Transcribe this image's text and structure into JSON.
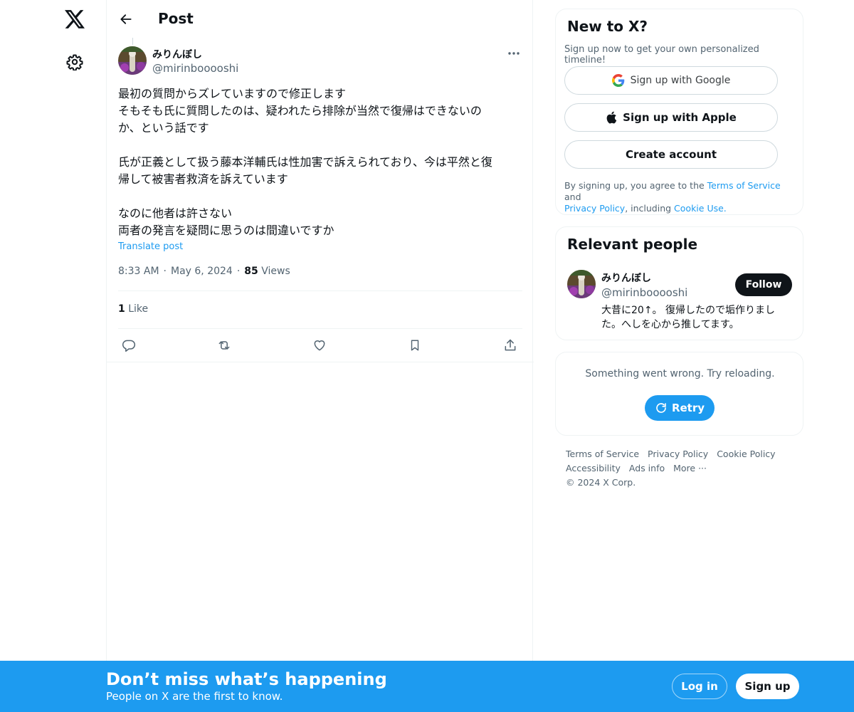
{
  "colors": {
    "accent": "#1d9bf0",
    "text": "#0f1419",
    "muted": "#536471",
    "border": "#eff3f4"
  },
  "nav": {
    "logo_icon": "x-logo-icon",
    "settings_icon": "gear-icon"
  },
  "header": {
    "title": "Post"
  },
  "post": {
    "author_name": "みりんぼし",
    "author_handle": "@mirinbooooshi",
    "more_label": "···",
    "text": "最初の質問からズレていますので修正します\nそもそも氏に質問したのは、疑われたら排除が当然で復帰はできないの\nか、という話です\n\n氏が正義として扱う藤本洋輔氏は性加害で訴えられており、今は平然と復\n帰して被害者救済を訴えています\n\nなのに他者は許さない\n両者の発言を疑問に思うのは間違いですか",
    "translate_label": "Translate post",
    "time": "8:33 AM",
    "date": "May 6, 2024",
    "views_count": "85",
    "views_label": "Views",
    "likes_count": "1",
    "likes_label": "Like"
  },
  "signup_card": {
    "title": "New to X?",
    "subtitle": "Sign up now to get your own personalized timeline!",
    "google_label": "Sign up with Google",
    "apple_label": "Sign up with Apple",
    "create_label": "Create account",
    "legal_prefix": "By signing up, you agree to the ",
    "terms_label": "Terms of Service",
    "legal_and": " and",
    "privacy_label": "Privacy Policy",
    "legal_including": ", including ",
    "cookie_label": "Cookie Use."
  },
  "relevant_people": {
    "title": "Relevant people",
    "name": "みりんぼし",
    "handle": "@mirinbooooshi",
    "follow_label": "Follow",
    "bio": "大昔に20↑。 復帰したので垢作りました。へしを心から推してます。"
  },
  "error_card": {
    "message": "Something went wrong. Try reloading.",
    "retry_label": "Retry"
  },
  "footer": {
    "links": [
      "Terms of Service",
      "Privacy Policy",
      "Cookie Policy",
      "Accessibility",
      "Ads info",
      "More ···",
      "© 2024 X Corp."
    ]
  },
  "banner": {
    "title": "Don’t miss what’s happening",
    "subtitle": "People on X are the first to know.",
    "login_label": "Log in",
    "signup_label": "Sign up"
  }
}
